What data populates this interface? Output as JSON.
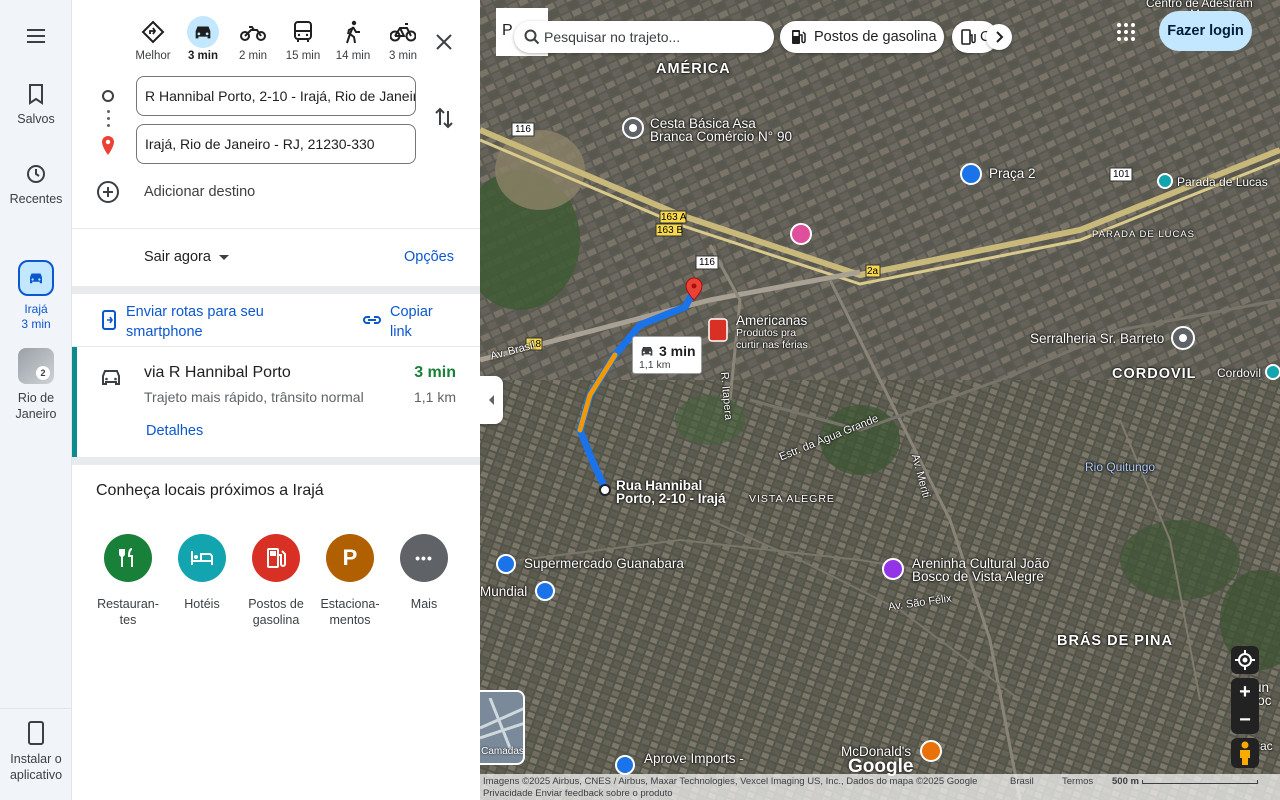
{
  "rail": {
    "menu_icon": "menu-icon",
    "saved_label": "Salvos",
    "recent_label": "Recentes",
    "trip1_label_line1": "Irajá",
    "trip1_label_line2": "3 min",
    "trip2_badge": "2",
    "trip2_label_line1": "Rio de",
    "trip2_label_line2": "Janeiro",
    "install_line1": "Instalar o",
    "install_line2": "aplicativo"
  },
  "modes": [
    {
      "name": "best",
      "label": "Melhor"
    },
    {
      "name": "car",
      "label": "3 min"
    },
    {
      "name": "motorcycle",
      "label": "2 min"
    },
    {
      "name": "transit",
      "label": "15 min"
    },
    {
      "name": "walk",
      "label": "14 min"
    },
    {
      "name": "bike",
      "label": "3 min"
    }
  ],
  "inputs": {
    "origin": "R Hannibal Porto, 2-10 - Irajá, Rio de Janeiro",
    "destination": "Irajá, Rio de Janeiro - RJ, 21230-330",
    "add_destination": "Adicionar destino"
  },
  "depart": {
    "label": "Sair agora",
    "options": "Opções"
  },
  "send": {
    "phone_line1": "Enviar rotas para seu",
    "phone_line2": "smartphone",
    "copy_line1": "Copiar",
    "copy_line2": "link"
  },
  "route": {
    "via": "via R Hannibal Porto",
    "time": "3 min",
    "description": "Trajeto mais rápido, trânsito normal",
    "distance": "1,1 km",
    "details": "Detalhes"
  },
  "nearby": {
    "title": "Conheça locais próximos a Irajá",
    "categories": [
      {
        "line1": "Restauran-",
        "line2": "tes",
        "color": "#188038",
        "icon": "fork-knife-icon"
      },
      {
        "line1": "Hotéis",
        "line2": "",
        "color": "#12a4af",
        "icon": "bed-icon"
      },
      {
        "line1": "Postos de",
        "line2": "gasolina",
        "color": "#d93025",
        "icon": "gas-pump-icon"
      },
      {
        "line1": "Estaciona-",
        "line2": "mentos",
        "color": "#b06000",
        "icon": "parking-icon",
        "glyph": "P"
      },
      {
        "line1": "Mais",
        "line2": "",
        "color": "#5f6368",
        "icon": "more-icon",
        "glyph": "•••"
      }
    ]
  },
  "map": {
    "search_placeholder": "Pesquisar no trajeto...",
    "chip_gas": "Postos de gasolina",
    "chip_second": "C",
    "login": "Fazer login",
    "layers_label": "Camadas",
    "route_badge_time": "3 min",
    "route_badge_dist": "1,1 km",
    "google": "Google",
    "labels": {
      "america": "AMÉRICA",
      "cordovil": "CORDOVIL",
      "bras_de_pina": "BRÁS DE PINA",
      "vista_alegre": "VISTA ALEGRE",
      "parada_lucas_area": "PARADA DE LUCAS",
      "cesta_basica_1": "Cesta Básica Asa",
      "cesta_basica_2": "Branca Comércio N° 90",
      "praca2": "Praça 2",
      "parada_lucas": "Parada de Lucas",
      "americanas_1": "Americanas",
      "americanas_2": "Produtos pra",
      "americanas_3": "curtir nas férias",
      "serralheria": "Serralheria Sr. Barreto",
      "cordovil_small": "Cordovil",
      "rio_quitungo": "Rio Quitungo",
      "hannibal_1": "Rua Hannibal",
      "hannibal_2": "Porto, 2-10 - Irajá",
      "supermercado": "Supermercado Guanabara",
      "mundial": "Mundial",
      "areninha_1": "Areninha Cultural João",
      "areninha_2": "Bosco de Vista Alegre",
      "aprove": "Aprove Imports -",
      "mcdonalds": "McDonald's",
      "sun_1": "Sun",
      "sun_2": "Troc",
      "r_cac": "R. Cac",
      "centro_adest": "Centro de Adestram",
      "marques": "Marques",
      "estr_agua_grande": "Estr. da Água Grande",
      "av_brasil": "Av. Brasil",
      "av_meriti": "Av. Meriti",
      "r_itapera": "R. Itapera",
      "av_sao_felix": "Av. São Félix",
      "road_116a": "116",
      "road_116b": "116",
      "road_163a": "163 A",
      "road_163b": "163 B",
      "road_2a": "2a",
      "road_101": "101",
      "road_18": "18",
      "america_p": "P"
    },
    "attribution_line1": "Imagens ©2025 Airbus, CNES / Airbus, Maxar Technologies, Vexcel Imaging US, Inc., Dados do mapa ©2025 Google",
    "attribution_line2": "Privacidade    Enviar feedback sobre o produto",
    "brasil": "Brasil",
    "termos": "Termos",
    "scale": "500 m"
  }
}
